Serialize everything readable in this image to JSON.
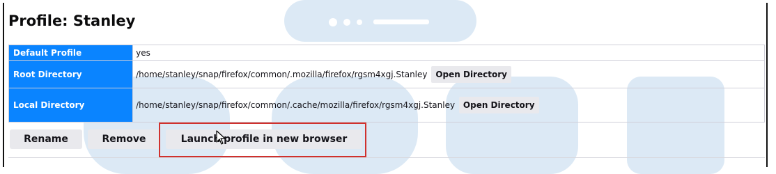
{
  "profile": {
    "title": "Profile: Stanley",
    "rows": [
      {
        "label": "Default Profile",
        "value": "yes"
      },
      {
        "label": "Root Directory",
        "value": "/home/stanley/snap/firefox/common/.mozilla/firefox/rgsm4xgj.Stanley",
        "button": "Open Directory"
      },
      {
        "label": "Local Directory",
        "value": "/home/stanley/snap/firefox/common/.cache/mozilla/firefox/rgsm4xgj.Stanley",
        "button": "Open Directory"
      }
    ]
  },
  "actions": {
    "rename": "Rename",
    "remove": "Remove",
    "launch": "Launch profile in new browser"
  },
  "colors": {
    "header_bg": "#0a84ff",
    "highlight_border": "#d0312d",
    "button_bg": "#e9e9ed",
    "watermark": "#cfe0f0"
  }
}
